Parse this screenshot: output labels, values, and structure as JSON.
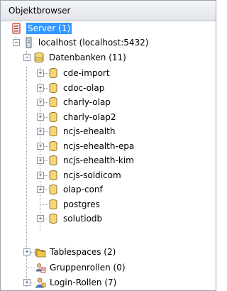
{
  "panel": {
    "title": "Objektbrowser"
  },
  "tree": {
    "server": {
      "label": "Server (1)"
    },
    "host": {
      "label": "localhost (localhost:5432)"
    },
    "databases": {
      "label": "Datenbanken (11)",
      "items": [
        {
          "label": "cde-import",
          "expandable": true
        },
        {
          "label": "cdoc-olap",
          "expandable": true
        },
        {
          "label": "charly-olap",
          "expandable": true
        },
        {
          "label": "charly-olap2",
          "expandable": true
        },
        {
          "label": "ncjs-ehealth",
          "expandable": true
        },
        {
          "label": "ncjs-ehealth-epa",
          "expandable": true
        },
        {
          "label": "ncjs-ehealth-kim",
          "expandable": true
        },
        {
          "label": "ncjs-soldicom",
          "expandable": true
        },
        {
          "label": "olap-conf",
          "expandable": true
        },
        {
          "label": "postgres",
          "expandable": false
        },
        {
          "label": "solutiodb",
          "expandable": true
        }
      ]
    },
    "tablespaces": {
      "label": "Tablespaces (2)"
    },
    "group_roles": {
      "label": "Gruppenrollen (0)"
    },
    "login_roles": {
      "label": "Login-Rollen (7)"
    }
  },
  "glyphs": {
    "expand": "+",
    "collapse": "−"
  },
  "colors": {
    "selection": "#3399ff",
    "db_icon_fill": "#f5d67a",
    "folder_fill": "#f3c64f"
  }
}
